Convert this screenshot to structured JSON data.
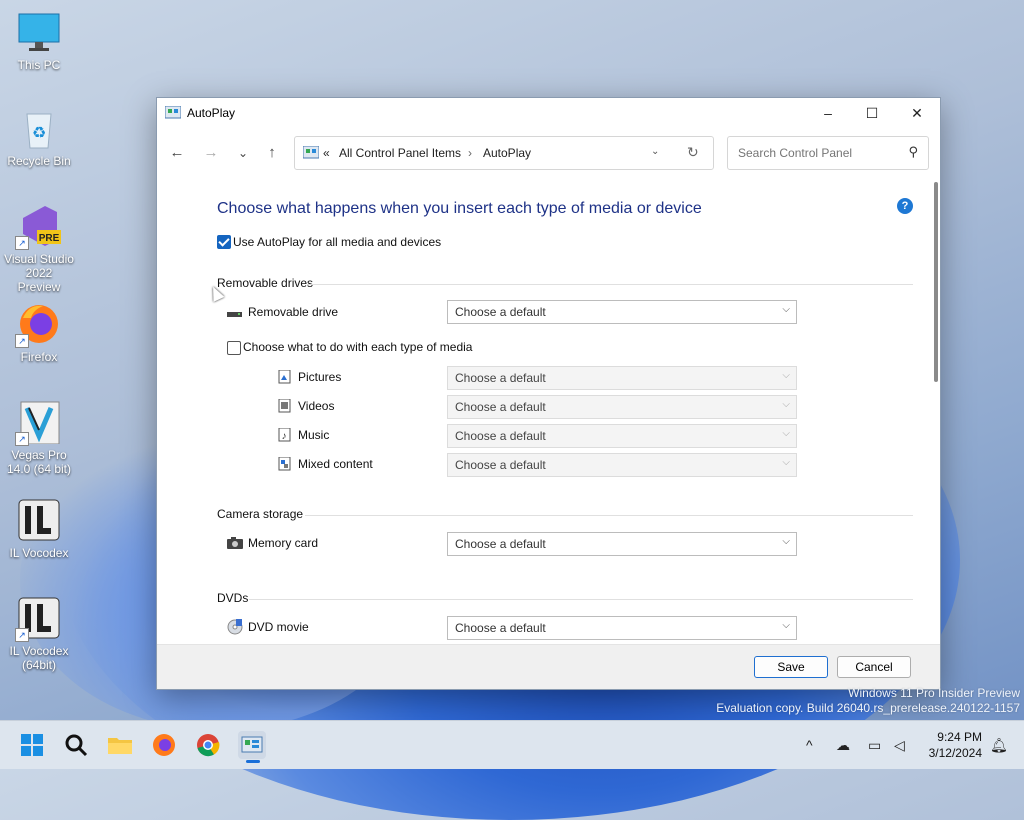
{
  "desktop": {
    "icons": [
      {
        "label": "This PC"
      },
      {
        "label": "Recycle Bin"
      },
      {
        "label": "Visual Studio 2022 Preview",
        "badge": "PRE"
      },
      {
        "label": "Firefox"
      },
      {
        "label": "Vegas Pro 14.0 (64 bit)"
      },
      {
        "label": "IL Vocodex"
      },
      {
        "label": "IL Vocodex (64bit)"
      }
    ],
    "watermark": {
      "line1": "Windows 11 Pro Insider Preview",
      "line2": "Evaluation copy. Build 26040.rs_prerelease.240122-1157"
    }
  },
  "window": {
    "title": "AutoPlay",
    "controls": {
      "minimize": "–",
      "maximize": "☐",
      "close": "✕"
    },
    "nav": {
      "back": "←",
      "forward": "→",
      "recent": "⌄",
      "up": "↑"
    },
    "address": {
      "overflow": "«",
      "crumbs": [
        "All Control Panel Items",
        "AutoPlay"
      ],
      "separator": "›"
    },
    "search": {
      "placeholder": "Search Control Panel"
    },
    "heading": "Choose what happens when you insert each type of media or device",
    "help": "?",
    "use_autoplay": {
      "label": "Use AutoPlay for all media and devices",
      "checked": true
    },
    "sections": {
      "removable": {
        "title": "Removable drives",
        "drive_label": "Removable drive",
        "drive_value": "Choose a default",
        "per_media_label": "Choose what to do with each type of media",
        "per_media_checked": false,
        "media": [
          {
            "label": "Pictures",
            "value": "Choose a default"
          },
          {
            "label": "Videos",
            "value": "Choose a default"
          },
          {
            "label": "Music",
            "value": "Choose a default"
          },
          {
            "label": "Mixed content",
            "value": "Choose a default"
          }
        ]
      },
      "camera": {
        "title": "Camera storage",
        "item_label": "Memory card",
        "item_value": "Choose a default"
      },
      "dvds": {
        "title": "DVDs",
        "item_label": "DVD movie",
        "item_value": "Choose a default"
      }
    },
    "footer": {
      "save": "Save",
      "cancel": "Cancel"
    }
  },
  "taskbar": {
    "apps": [
      "Start",
      "Search",
      "File Explorer",
      "Firefox",
      "Chrome",
      "Control Panel"
    ],
    "tray": {
      "chevron": "^"
    },
    "time": "9:24 PM",
    "date": "3/12/2024"
  },
  "colors": {
    "accent": "#1565c0",
    "heading": "#1e3287"
  }
}
